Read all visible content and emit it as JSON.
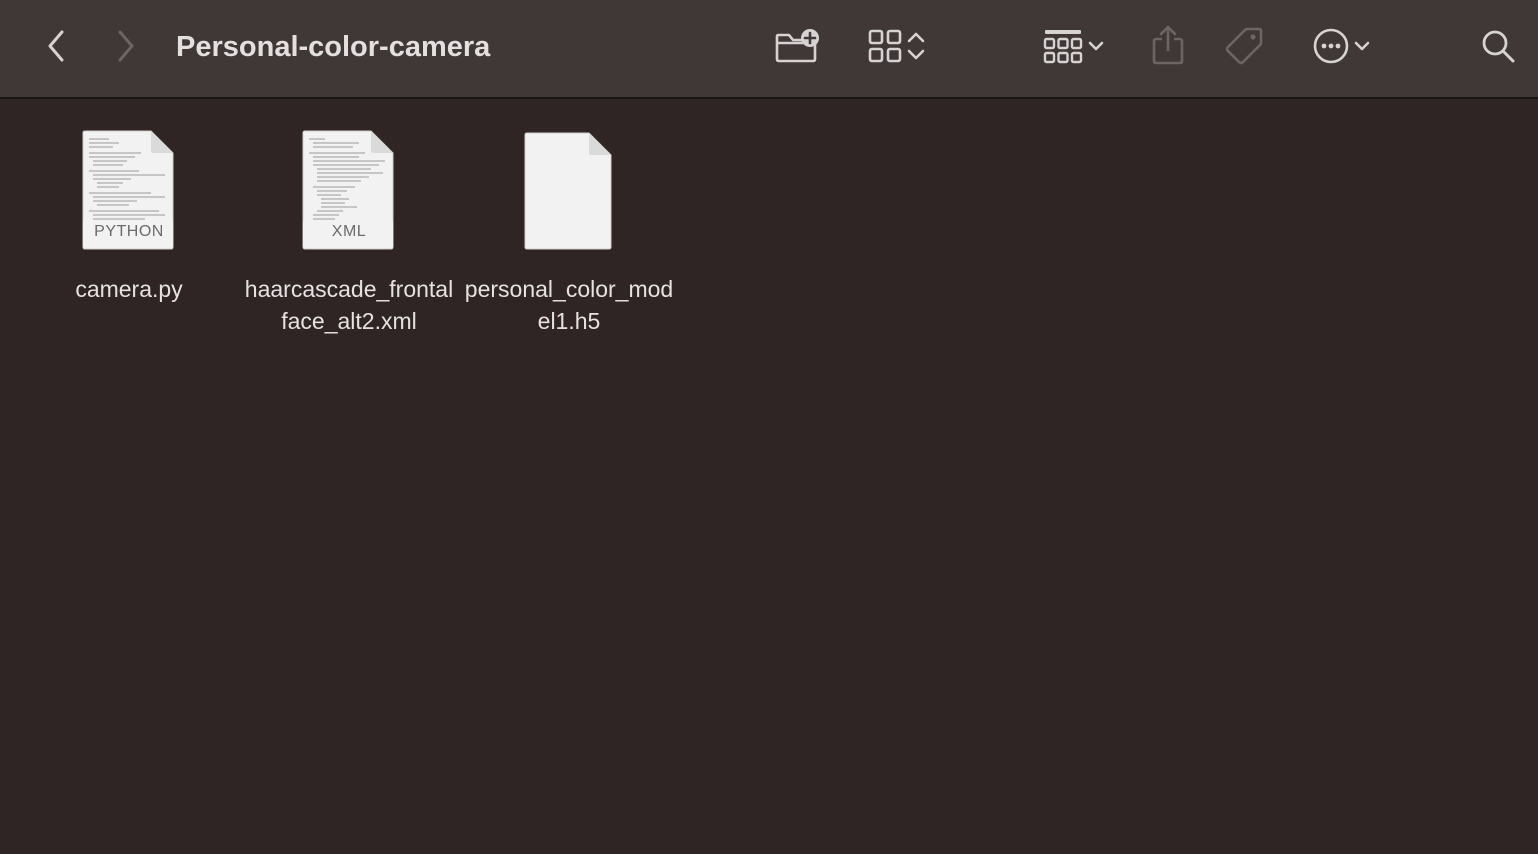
{
  "window": {
    "title": "Personal-color-camera"
  },
  "toolbar": {
    "buttons": [
      {
        "name": "back",
        "icon": "chevron-left-icon"
      },
      {
        "name": "forward",
        "icon": "chevron-right-icon"
      },
      {
        "name": "new-folder",
        "icon": "folder-plus-icon"
      },
      {
        "name": "view-mode",
        "icon": "grid-icon"
      },
      {
        "name": "group-by",
        "icon": "group-grid-icon"
      },
      {
        "name": "share",
        "icon": "share-icon"
      },
      {
        "name": "tags",
        "icon": "tag-icon"
      },
      {
        "name": "more-actions",
        "icon": "ellipsis-circle-icon"
      },
      {
        "name": "search",
        "icon": "search-icon"
      }
    ]
  },
  "files": [
    {
      "name": "camera.py",
      "ext_label": "PYTHON",
      "kind": "text"
    },
    {
      "name": "haarcascade_frontalface_alt2.xml",
      "ext_label": "XML",
      "kind": "text"
    },
    {
      "name": "personal_color_model1.h5",
      "ext_label": "",
      "kind": "blank"
    }
  ],
  "colors": {
    "toolbar_bg": "#403737",
    "content_bg": "#2f2525",
    "text": "#e6e2e2",
    "icon": "#d8d3d3",
    "icon_disabled": "#6d6565"
  }
}
